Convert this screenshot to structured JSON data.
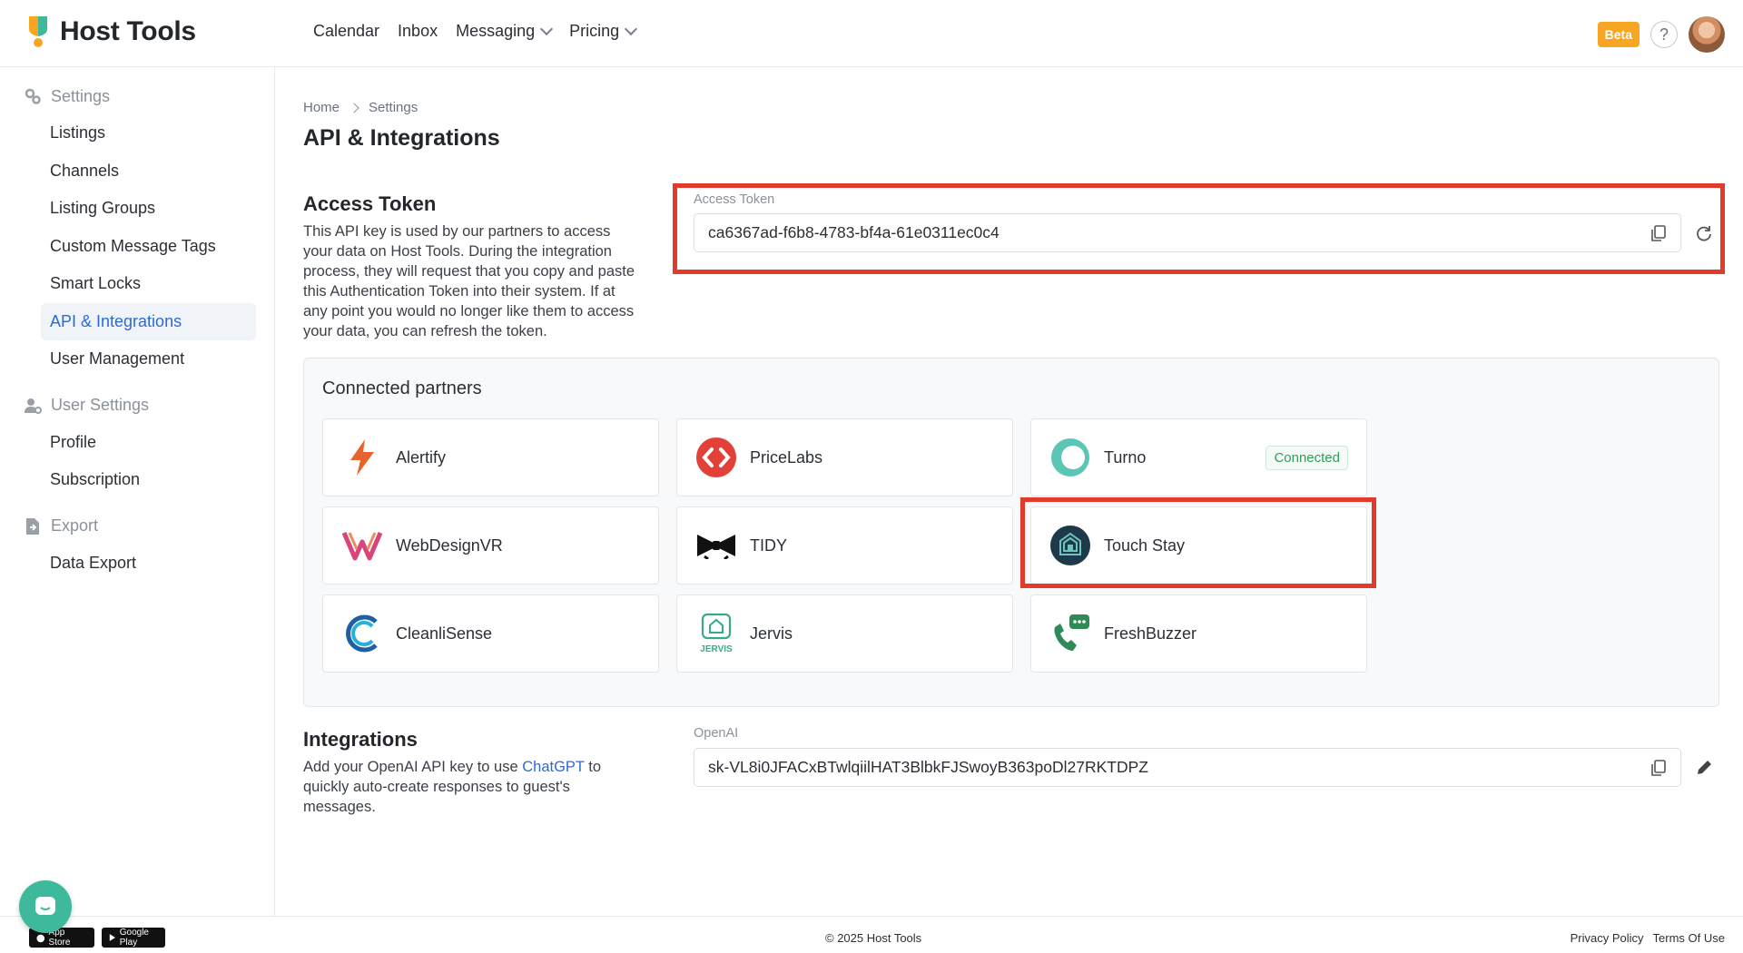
{
  "brand": {
    "name": "Host Tools"
  },
  "topnav": {
    "items": [
      {
        "label": "Calendar",
        "dropdown": false
      },
      {
        "label": "Inbox",
        "dropdown": false
      },
      {
        "label": "Messaging",
        "dropdown": true
      },
      {
        "label": "Pricing",
        "dropdown": true
      }
    ],
    "beta": "Beta",
    "help": "?"
  },
  "sidebar": {
    "sections": [
      {
        "title": "Settings",
        "icon": "gears-icon",
        "items": [
          "Listings",
          "Channels",
          "Listing Groups",
          "Custom Message Tags",
          "Smart Locks",
          "API & Integrations",
          "User Management"
        ]
      },
      {
        "title": "User Settings",
        "icon": "user-gear-icon",
        "items": [
          "Profile",
          "Subscription"
        ]
      },
      {
        "title": "Export",
        "icon": "file-export-icon",
        "items": [
          "Data Export"
        ]
      }
    ],
    "active": "API & Integrations"
  },
  "breadcrumb": [
    "Home",
    "Settings"
  ],
  "page_title": "API & Integrations",
  "access_token": {
    "title": "Access Token",
    "description": "This API key is used by our partners to access your data on Host Tools. During the integration process, they will request that you copy and paste this Authentication Token into their system. If at any point you would no longer like them to access your data, you can refresh the token.",
    "field_label": "Access Token",
    "value": "ca6367ad-f6b8-4783-bf4a-61e0311ec0c4"
  },
  "partners": {
    "title": "Connected partners",
    "items": [
      {
        "name": "Alertify",
        "icon": "lightning-bolt-icon",
        "color": "#e8622c"
      },
      {
        "name": "PriceLabs",
        "icon": "pricelabs-logo-icon",
        "color": "#e2413a"
      },
      {
        "name": "Turno",
        "icon": "turno-logo-icon",
        "color": "#5cc6b4",
        "status": "Connected"
      },
      {
        "name": "WebDesignVR",
        "icon": "webdesignvr-logo-icon",
        "color": "#d9447a"
      },
      {
        "name": "TIDY",
        "icon": "bowtie-icon",
        "color": "#111111"
      },
      {
        "name": "Touch Stay",
        "icon": "touchstay-logo-icon",
        "color": "#1e3a4a"
      },
      {
        "name": "CleanliSense",
        "icon": "cleanlisense-logo-icon",
        "color": "#1f8fc6"
      },
      {
        "name": "Jervis",
        "icon": "jervis-logo-icon",
        "color": "#3aa98a"
      },
      {
        "name": "FreshBuzzer",
        "icon": "phone-chat-icon",
        "color": "#2f8a58"
      }
    ]
  },
  "integrations": {
    "title": "Integrations",
    "desc_before": "Add your OpenAI API key to use ",
    "link": "ChatGPT",
    "desc_after": " to quickly auto-create responses to guest's messages.",
    "field_label": "OpenAI",
    "value": "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"
  },
  "footer": {
    "copyright": "© 2025 Host Tools",
    "links": [
      "Privacy Policy",
      "Terms Of Use"
    ],
    "stores": [
      "App Store",
      "Google Play"
    ]
  },
  "colors": {
    "accent": "#2c6bd6",
    "highlight": "#e23a2b",
    "beta": "#f6a623",
    "chat": "#3fb99b"
  }
}
